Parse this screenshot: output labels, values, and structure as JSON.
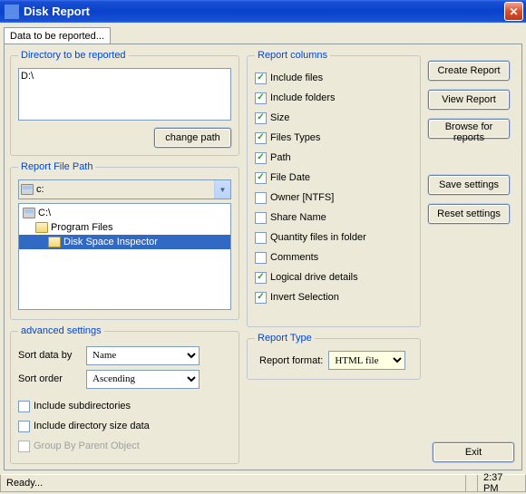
{
  "window": {
    "title": "Disk Report",
    "close": "✕"
  },
  "tabs": {
    "data_tab": "Data to be reported..."
  },
  "directory": {
    "legend": "Directory to be reported",
    "value": "D:\\",
    "change_path": "change path"
  },
  "report_file_path": {
    "legend": "Report File Path",
    "drive": "c:",
    "tree": {
      "root": "C:\\",
      "child1": "Program Files",
      "child2": "Disk Space Inspector"
    }
  },
  "advanced": {
    "legend": "advanced settings",
    "sort_by_label": "Sort data by",
    "sort_by_value": "Name",
    "sort_order_label": "Sort order",
    "sort_order_value": "Ascending",
    "include_subdirs": "Include subdirectories",
    "include_dir_size": "Include directory size data",
    "group_by_parent": "Group By Parent Object"
  },
  "columns": {
    "legend": "Report columns",
    "items": [
      {
        "label": "Include files",
        "checked": true
      },
      {
        "label": "Include folders",
        "checked": true
      },
      {
        "label": "Size",
        "checked": true
      },
      {
        "label": "Files Types",
        "checked": true
      },
      {
        "label": "Path",
        "checked": true
      },
      {
        "label": "File Date",
        "checked": true
      },
      {
        "label": "Owner [NTFS]",
        "checked": false
      },
      {
        "label": "Share Name",
        "checked": false
      },
      {
        "label": "Quantity files in folder",
        "checked": false
      },
      {
        "label": "Comments",
        "checked": false
      },
      {
        "label": "Logical drive details",
        "checked": true
      },
      {
        "label": "Invert Selection",
        "checked": true
      }
    ]
  },
  "report_type": {
    "legend": "Report Type",
    "format_label": "Report format:",
    "format_value": "HTML file"
  },
  "buttons": {
    "create": "Create Report",
    "view": "View Report",
    "browse": "Browse for reports",
    "save_settings": "Save settings",
    "reset_settings": "Reset settings",
    "exit": "Exit"
  },
  "status": {
    "ready": "Ready...",
    "time": "2:37 PM"
  }
}
